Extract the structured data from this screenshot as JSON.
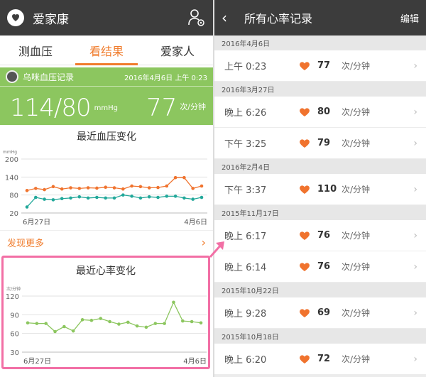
{
  "left": {
    "app_title": "爱家康",
    "tabs": [
      {
        "label": "测血压",
        "active": false
      },
      {
        "label": "看结果",
        "active": true
      },
      {
        "label": "爱家人",
        "active": false
      }
    ],
    "bp_card": {
      "name": "乌咪血压记录",
      "date": "2016年4月6日 上午 0:23",
      "pressure": "114/80",
      "pressure_unit": "mmHg",
      "pulse": "77",
      "pulse_unit": "次/分钟"
    },
    "more_label": "发现更多"
  },
  "chart_data": [
    {
      "type": "line",
      "title": "最近血压变化",
      "ylabel": "mmHg",
      "ylim": [
        20,
        200
      ],
      "yticks": [
        20,
        80,
        140,
        200
      ],
      "x_start_label": "6月27日",
      "x_end_label": "4月6日",
      "series": [
        {
          "color": "#f0732e",
          "values": [
            95,
            102,
            98,
            108,
            100,
            104,
            102,
            104,
            103,
            106,
            104,
            100,
            110,
            108,
            104,
            105,
            110,
            138,
            138,
            102,
            110
          ]
        },
        {
          "color": "#22a89a",
          "values": [
            40,
            72,
            66,
            64,
            68,
            70,
            74,
            70,
            72,
            70,
            70,
            80,
            76,
            70,
            74,
            72,
            76,
            76,
            70,
            66,
            72
          ]
        }
      ]
    },
    {
      "type": "line",
      "title": "最近心率变化",
      "ylabel": "次/分钟",
      "ylim": [
        30,
        120
      ],
      "yticks": [
        30,
        60,
        90,
        120
      ],
      "x_start_label": "6月27日",
      "x_end_label": "4月6日",
      "series": [
        {
          "color": "#8cc65f",
          "values": [
            77,
            76,
            76,
            63,
            71,
            64,
            82,
            81,
            84,
            79,
            75,
            78,
            72,
            70,
            76,
            76,
            110,
            80,
            79,
            77
          ]
        }
      ]
    }
  ],
  "right": {
    "title": "所有心率记录",
    "edit_label": "编辑",
    "groups": [
      {
        "date": "2016年4月6日",
        "records": [
          {
            "time": "上午 0:23",
            "value": "77",
            "unit": "次/分钟"
          }
        ]
      },
      {
        "date": "2016年3月27日",
        "records": [
          {
            "time": "晚上 6:26",
            "value": "80",
            "unit": "次/分钟"
          },
          {
            "time": "下午 3:25",
            "value": "79",
            "unit": "次/分钟"
          }
        ]
      },
      {
        "date": "2016年2月4日",
        "records": [
          {
            "time": "下午 3:37",
            "value": "110",
            "unit": "次/分钟"
          }
        ]
      },
      {
        "date": "2015年11月17日",
        "records": [
          {
            "time": "晚上 6:17",
            "value": "76",
            "unit": "次/分钟"
          },
          {
            "time": "晚上 6:14",
            "value": "76",
            "unit": "次/分钟"
          }
        ]
      },
      {
        "date": "2015年10月22日",
        "records": [
          {
            "time": "晚上 9:28",
            "value": "69",
            "unit": "次/分钟"
          }
        ]
      },
      {
        "date": "2015年10月18日",
        "records": [
          {
            "time": "晚上 6:20",
            "value": "72",
            "unit": "次/分钟"
          }
        ]
      }
    ]
  },
  "colors": {
    "accent": "#f07c2c",
    "card_green": "#8cc65f",
    "highlight": "#f26fa5",
    "heart": "#f0732e"
  }
}
